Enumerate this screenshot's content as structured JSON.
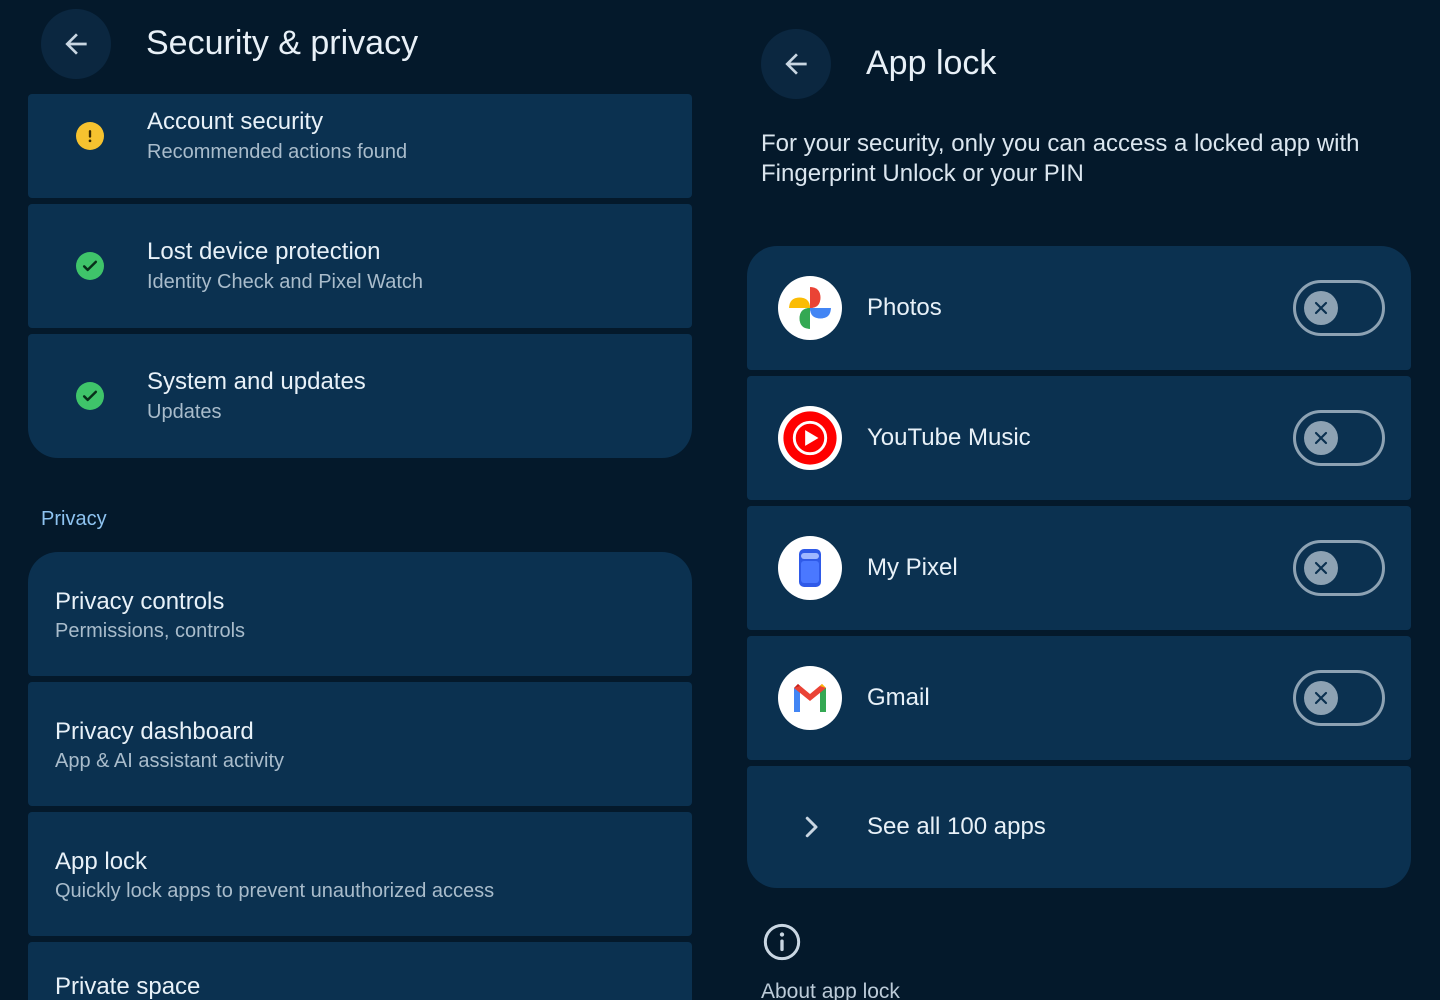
{
  "left": {
    "title": "Security & privacy",
    "security_items": [
      {
        "title": "Account security",
        "subtitle": "Recommended actions found",
        "status": "warning",
        "status_color": "#f6c22f"
      },
      {
        "title": "Lost device protection",
        "subtitle": "Identity Check and Pixel Watch",
        "status": "ok",
        "status_color": "#3fc46a"
      },
      {
        "title": "System and updates",
        "subtitle": "Updates",
        "status": "ok",
        "status_color": "#3fc46a"
      }
    ],
    "privacy_section_label": "Privacy",
    "privacy_items": [
      {
        "title": "Privacy controls",
        "subtitle": "Permissions, controls"
      },
      {
        "title": "Privacy dashboard",
        "subtitle": "App & AI assistant activity"
      },
      {
        "title": "App lock",
        "subtitle": "Quickly lock apps to prevent unauthorized access"
      },
      {
        "title": "Private space",
        "subtitle": ""
      }
    ]
  },
  "right": {
    "title": "App lock",
    "description": "For your security, only you can access a locked app with Fingerprint Unlock or your PIN",
    "apps": [
      {
        "name": "Photos",
        "icon": "photos-icon",
        "locked": false
      },
      {
        "name": "YouTube Music",
        "icon": "youtube-music-icon",
        "locked": false
      },
      {
        "name": "My Pixel",
        "icon": "my-pixel-icon",
        "locked": false
      },
      {
        "name": "Gmail",
        "icon": "gmail-icon",
        "locked": false
      }
    ],
    "see_all_label": "See all 100 apps",
    "about_label": "About app lock"
  },
  "colors": {
    "background": "#04192b",
    "card": "#0b3150",
    "accent_text": "#8ec3f0"
  }
}
